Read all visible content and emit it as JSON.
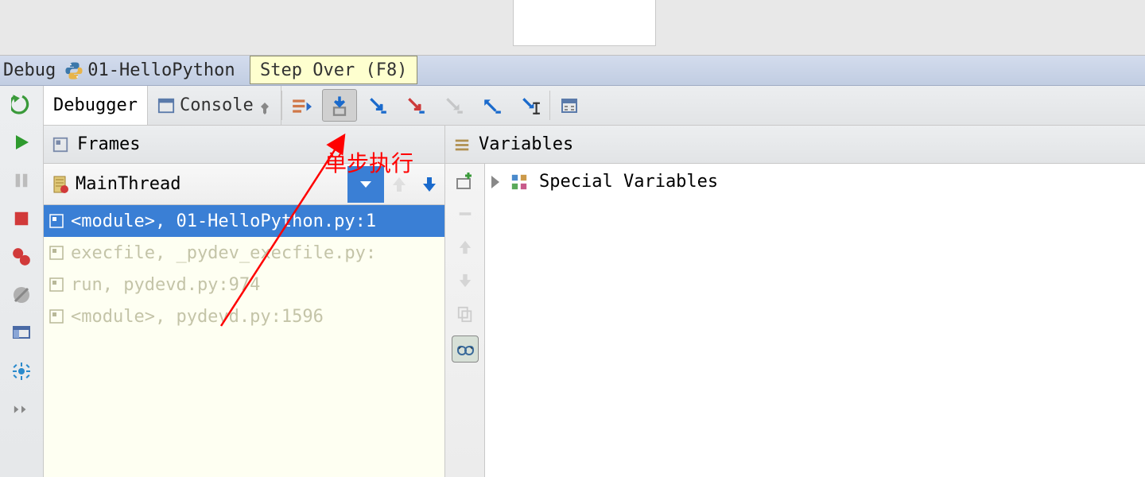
{
  "title_bar": {
    "label_debug": "Debug",
    "file_label": "01-HelloPython"
  },
  "tooltip": {
    "text": "Step Over (F8)"
  },
  "tabs": {
    "debugger": "Debugger",
    "console": "Console"
  },
  "panels": {
    "frames": "Frames",
    "variables": "Variables"
  },
  "thread": {
    "name": "MainThread"
  },
  "frames_list": [
    {
      "label": "<module>, 01-HelloPython.py:1",
      "selected": true
    },
    {
      "label": "execfile, _pydev_execfile.py:",
      "selected": false
    },
    {
      "label": "run, pydevd.py:974",
      "selected": false
    },
    {
      "label": "<module>, pydevd.py:1596",
      "selected": false
    }
  ],
  "variables": {
    "special": "Special Variables"
  },
  "annotation": {
    "text": "单步执行"
  }
}
